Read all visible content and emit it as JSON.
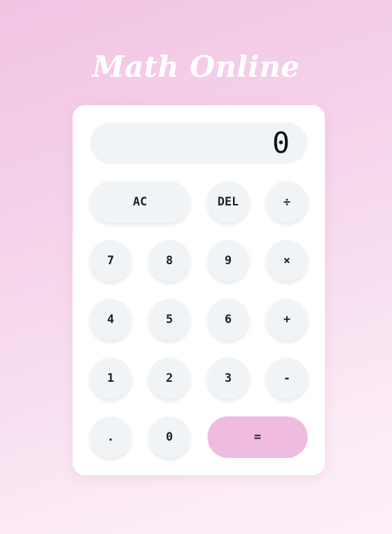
{
  "app": {
    "title": "Math Online"
  },
  "display": {
    "value": "0"
  },
  "keys": {
    "clear": "AC",
    "delete": "DEL",
    "divide": "÷",
    "seven": "7",
    "eight": "8",
    "nine": "9",
    "multiply": "×",
    "four": "4",
    "five": "5",
    "six": "6",
    "add": "+",
    "one": "1",
    "two": "2",
    "three": "3",
    "subtract": "-",
    "decimal": ".",
    "zero": "0",
    "equals": "="
  },
  "colors": {
    "equals_bg": "#f0bbe0",
    "key_bg": "#f1f4f7",
    "panel_bg": "#ffffff"
  }
}
